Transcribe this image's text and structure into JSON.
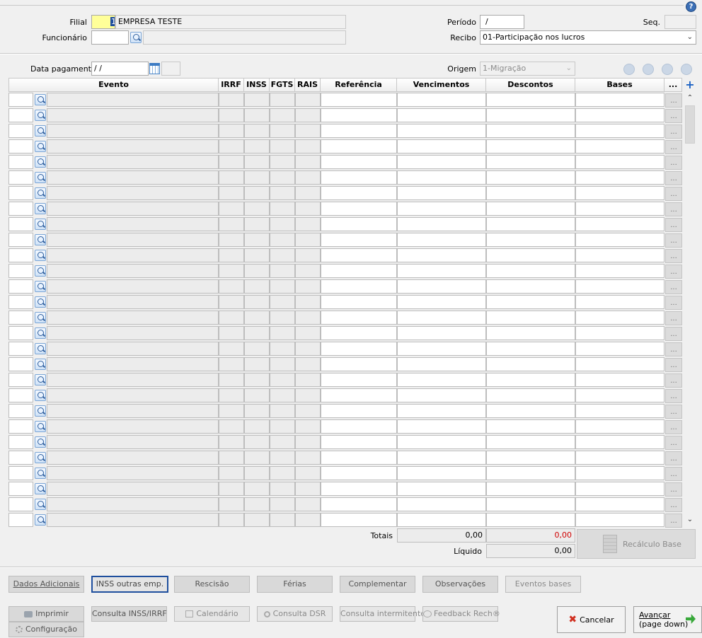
{
  "header": {
    "filial_label": "Filial",
    "filial_code": "1",
    "filial_name": "EMPRESA TESTE",
    "funcionario_label": "Funcionário",
    "funcionario_value": "",
    "funcionario_name": "",
    "periodo_label": "Período",
    "periodo_value": "/",
    "seq_label": "Seq.",
    "seq_value": "",
    "recibo_label": "Recibo",
    "recibo_value": "01-Participação nos lucros",
    "data_pagamento_label": "Data pagamento",
    "data_pagamento_value": " / /",
    "origem_label": "Origem",
    "origem_value": "1-Migração"
  },
  "grid": {
    "columns": [
      "Evento",
      "IRRF",
      "INSS",
      "FGTS",
      "RAIS",
      "Referência",
      "Vencimentos",
      "Descontos",
      "Bases",
      "..."
    ],
    "row_count": 28,
    "ellipsis_label": "..."
  },
  "totals": {
    "totais_label": "Totais",
    "vencimentos": "0,00",
    "descontos": "0,00",
    "liquido_label": "Líquido",
    "liquido": "0,00",
    "recalculo_label": "Recálculo Base"
  },
  "buttons_row1": {
    "dados_adicionais": "Dados Adicionais",
    "inss_outras": "INSS outras emp.",
    "rescisao": "Rescisão",
    "ferias": "Férias",
    "complementar": "Complementar",
    "observacoes": "Observações",
    "eventos_bases": "Eventos bases"
  },
  "buttons_row2": {
    "imprimir": "Imprimir",
    "consulta_inss": "Consulta INSS/IRRF",
    "calendario": "Calendário",
    "consulta_dsr": "Consulta DSR",
    "consulta_intermitente": "Consulta intermitente",
    "feedback": "Feedback Rech®",
    "configuracao": "Configuração",
    "cancelar": "Cancelar",
    "avancar_line1": "Avançar",
    "avancar_line2": "(page down)"
  },
  "colors": {
    "accent": "#1f4f9e",
    "descontos_total": "#d00000",
    "filial_code_bg": "#ffff99"
  }
}
